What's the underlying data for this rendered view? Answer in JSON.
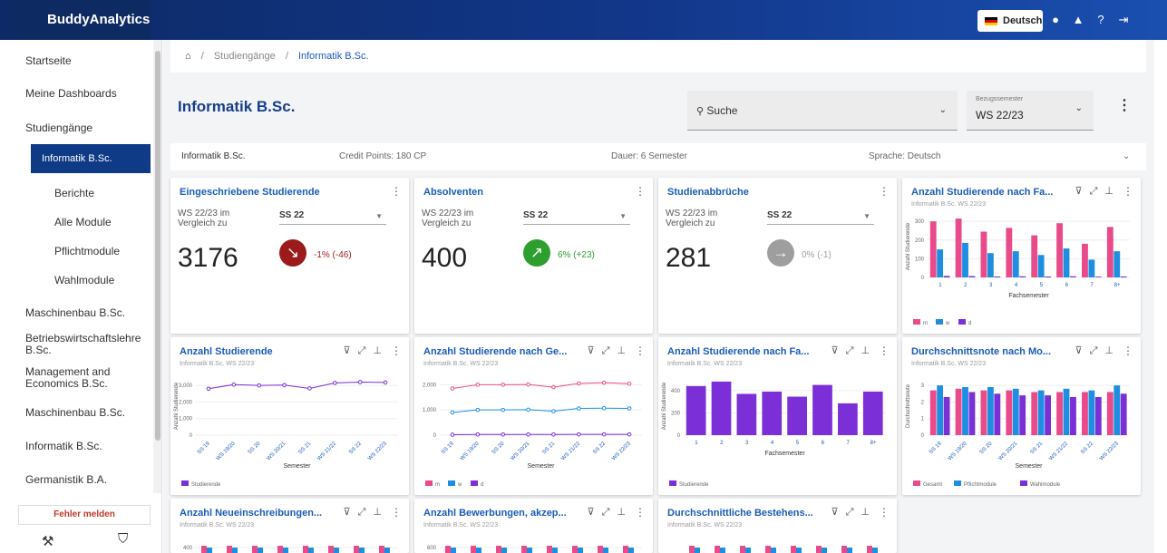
{
  "app": {
    "brand": "BuddyAnalytics",
    "language": "Deutsch"
  },
  "sidebar": {
    "items": [
      "Startseite",
      "Meine Dashboards",
      "Studiengänge"
    ],
    "active": "Informatik B.Sc.",
    "subitems": [
      "Berichte",
      "Alle Module",
      "Pflichtmodule",
      "Wahlmodule"
    ],
    "programs": [
      "Maschinenbau B.Sc.",
      "Betriebswirtschaftslehre B.Sc.",
      "Management and Economics B.Sc.",
      "Maschinenbau B.Sc.",
      "Informatik B.Sc.",
      "Germanistik B.A."
    ],
    "report_error": "Fehler melden"
  },
  "breadcrumb": {
    "section": "Studiengänge",
    "current": "Informatik B.Sc."
  },
  "page": {
    "title": "Informatik B.Sc.",
    "search_placeholder": "Suche",
    "semester_label": "Bezugssemester",
    "semester_value": "WS 22/23"
  },
  "info": {
    "name": "Informatik B.Sc.",
    "credits": "Credit Points: 180 CP",
    "duration": "Dauer: 6 Semester",
    "language": "Sprache: Deutsch"
  },
  "colors": {
    "pink": "#e84a8a",
    "blue": "#1e8fe0",
    "purple": "#7b2fd6",
    "down": "#9b1b1b",
    "up": "#2e9e2e",
    "flat": "#9e9e9e"
  },
  "kpis": [
    {
      "title": "Eingeschriebene Studierende",
      "compare": "WS 22/23 im Vergleich zu",
      "select": "SS 22",
      "value": "3176",
      "delta": "-1% (-46)",
      "trend": "down"
    },
    {
      "title": "Absolventen",
      "compare": "WS 22/23 im Vergleich zu",
      "select": "SS 22",
      "value": "400",
      "delta": "6% (+23)",
      "trend": "up"
    },
    {
      "title": "Studienabbrüche",
      "compare": "WS 22/23 im Vergleich zu",
      "select": "SS 22",
      "value": "281",
      "delta": "0% (-1)",
      "trend": "flat"
    }
  ],
  "chart_data": [
    {
      "type": "bar",
      "title": "Anzahl Studierende nach Fa...",
      "subtitle": "Informatik B.Sc. WS 22/23",
      "xlabel": "Fachsemester",
      "ylabel": "Anzahl Studierende",
      "categories": [
        "1",
        "2",
        "3",
        "4",
        "5",
        "6",
        "7",
        "8+"
      ],
      "ylim": [
        0,
        330
      ],
      "yticks": [
        "300",
        "200",
        "100",
        "0"
      ],
      "series": [
        {
          "name": "m",
          "values": [
            300,
            315,
            245,
            265,
            225,
            290,
            180,
            270
          ]
        },
        {
          "name": "w",
          "values": [
            150,
            185,
            130,
            140,
            120,
            155,
            95,
            140
          ]
        },
        {
          "name": "d",
          "values": [
            8,
            7,
            5,
            6,
            5,
            6,
            4,
            5
          ]
        }
      ],
      "legend": "bottom-left"
    },
    {
      "type": "line",
      "title": "Anzahl Studierende",
      "subtitle": "Informatik B.Sc. WS 22/23",
      "xlabel": "Semester",
      "ylabel": "Anzahl Studierende",
      "categories": [
        "SS 19",
        "WS 19/20",
        "SS 20",
        "WS 20/21",
        "SS 21",
        "WS 21/22",
        "SS 22",
        "WS 22/23"
      ],
      "ylim": [
        0,
        3500
      ],
      "yticks": [
        "3,000",
        "2,000",
        "1,000",
        "0"
      ],
      "series": [
        {
          "name": "Studierende",
          "values": [
            2800,
            3050,
            3000,
            3020,
            2820,
            3150,
            3200,
            3176
          ]
        }
      ],
      "legend": "bottom-left"
    },
    {
      "type": "line",
      "title": "Anzahl Studierende nach Ge...",
      "subtitle": "Informatik B.Sc. WS 22/23",
      "xlabel": "Semester",
      "categories": [
        "SS 19",
        "WS 19/20",
        "SS 20",
        "WS 20/21",
        "SS 21",
        "WS 21/22",
        "SS 22",
        "WS 22/23"
      ],
      "ylim": [
        0,
        2300
      ],
      "yticks": [
        "2,000",
        "1,000",
        "0"
      ],
      "series": [
        {
          "name": "m",
          "values": [
            1850,
            2000,
            2000,
            2010,
            1900,
            2050,
            2080,
            2040
          ]
        },
        {
          "name": "w",
          "values": [
            900,
            1000,
            1000,
            1010,
            950,
            1060,
            1070,
            1060
          ]
        },
        {
          "name": "d",
          "values": [
            20,
            25,
            25,
            25,
            25,
            30,
            30,
            30
          ]
        }
      ],
      "legend": "bottom-left"
    },
    {
      "type": "bar",
      "title": "Anzahl Studierende nach Fa...",
      "subtitle": "Informatik B.Sc. WS 22/23",
      "xlabel": "Fachsemester",
      "ylabel": "Anzahl Studierende",
      "categories": [
        "1",
        "2",
        "3",
        "4",
        "5",
        "6",
        "7",
        "8+"
      ],
      "ylim": [
        0,
        520
      ],
      "yticks": [
        "400",
        "200",
        "0"
      ],
      "series": [
        {
          "name": "Studierende",
          "values": [
            440,
            480,
            370,
            390,
            345,
            450,
            285,
            390
          ]
        }
      ],
      "legend": "bottom-left"
    },
    {
      "type": "bar",
      "title": "Durchschnittsnote nach Mo...",
      "subtitle": "Informatik B.Sc. WS 22/23",
      "xlabel": "Semester",
      "ylabel": "Durchschnittsnote",
      "categories": [
        "SS 19",
        "WS 19/20",
        "SS 20",
        "WS 20/21",
        "SS 21",
        "WS 21/22",
        "SS 22",
        "WS 22/23"
      ],
      "ylim": [
        0,
        3.5
      ],
      "yticks": [
        "3",
        "2",
        "1",
        "0"
      ],
      "series": [
        {
          "name": "Gesamt",
          "values": [
            2.7,
            2.8,
            2.7,
            2.7,
            2.6,
            2.6,
            2.6,
            2.6
          ]
        },
        {
          "name": "Pflichtmodule",
          "values": [
            3.0,
            2.9,
            2.9,
            2.8,
            2.7,
            2.8,
            2.7,
            3.0
          ]
        },
        {
          "name": "Wahlmodule",
          "values": [
            2.3,
            2.6,
            2.5,
            2.4,
            2.4,
            2.3,
            2.3,
            2.5
          ]
        }
      ],
      "legend": "bottom-left"
    },
    {
      "type": "bar",
      "title": "Anzahl Neueinschreibungen...",
      "subtitle": "Informatik B.Sc. WS 22/23",
      "categories": [],
      "yticks": [
        "400"
      ],
      "series": [],
      "legend": ""
    },
    {
      "type": "bar",
      "title": "Anzahl Bewerbungen, akzep...",
      "subtitle": "Informatik B.Sc. WS 22/23",
      "categories": [],
      "yticks": [
        "600"
      ],
      "series": [],
      "legend": ""
    },
    {
      "type": "bar",
      "title": "Durchschnittliche Bestehens...",
      "subtitle": "Informatik B.Sc. WS 22/23",
      "categories": [],
      "yticks": [],
      "series": [],
      "legend": ""
    }
  ]
}
